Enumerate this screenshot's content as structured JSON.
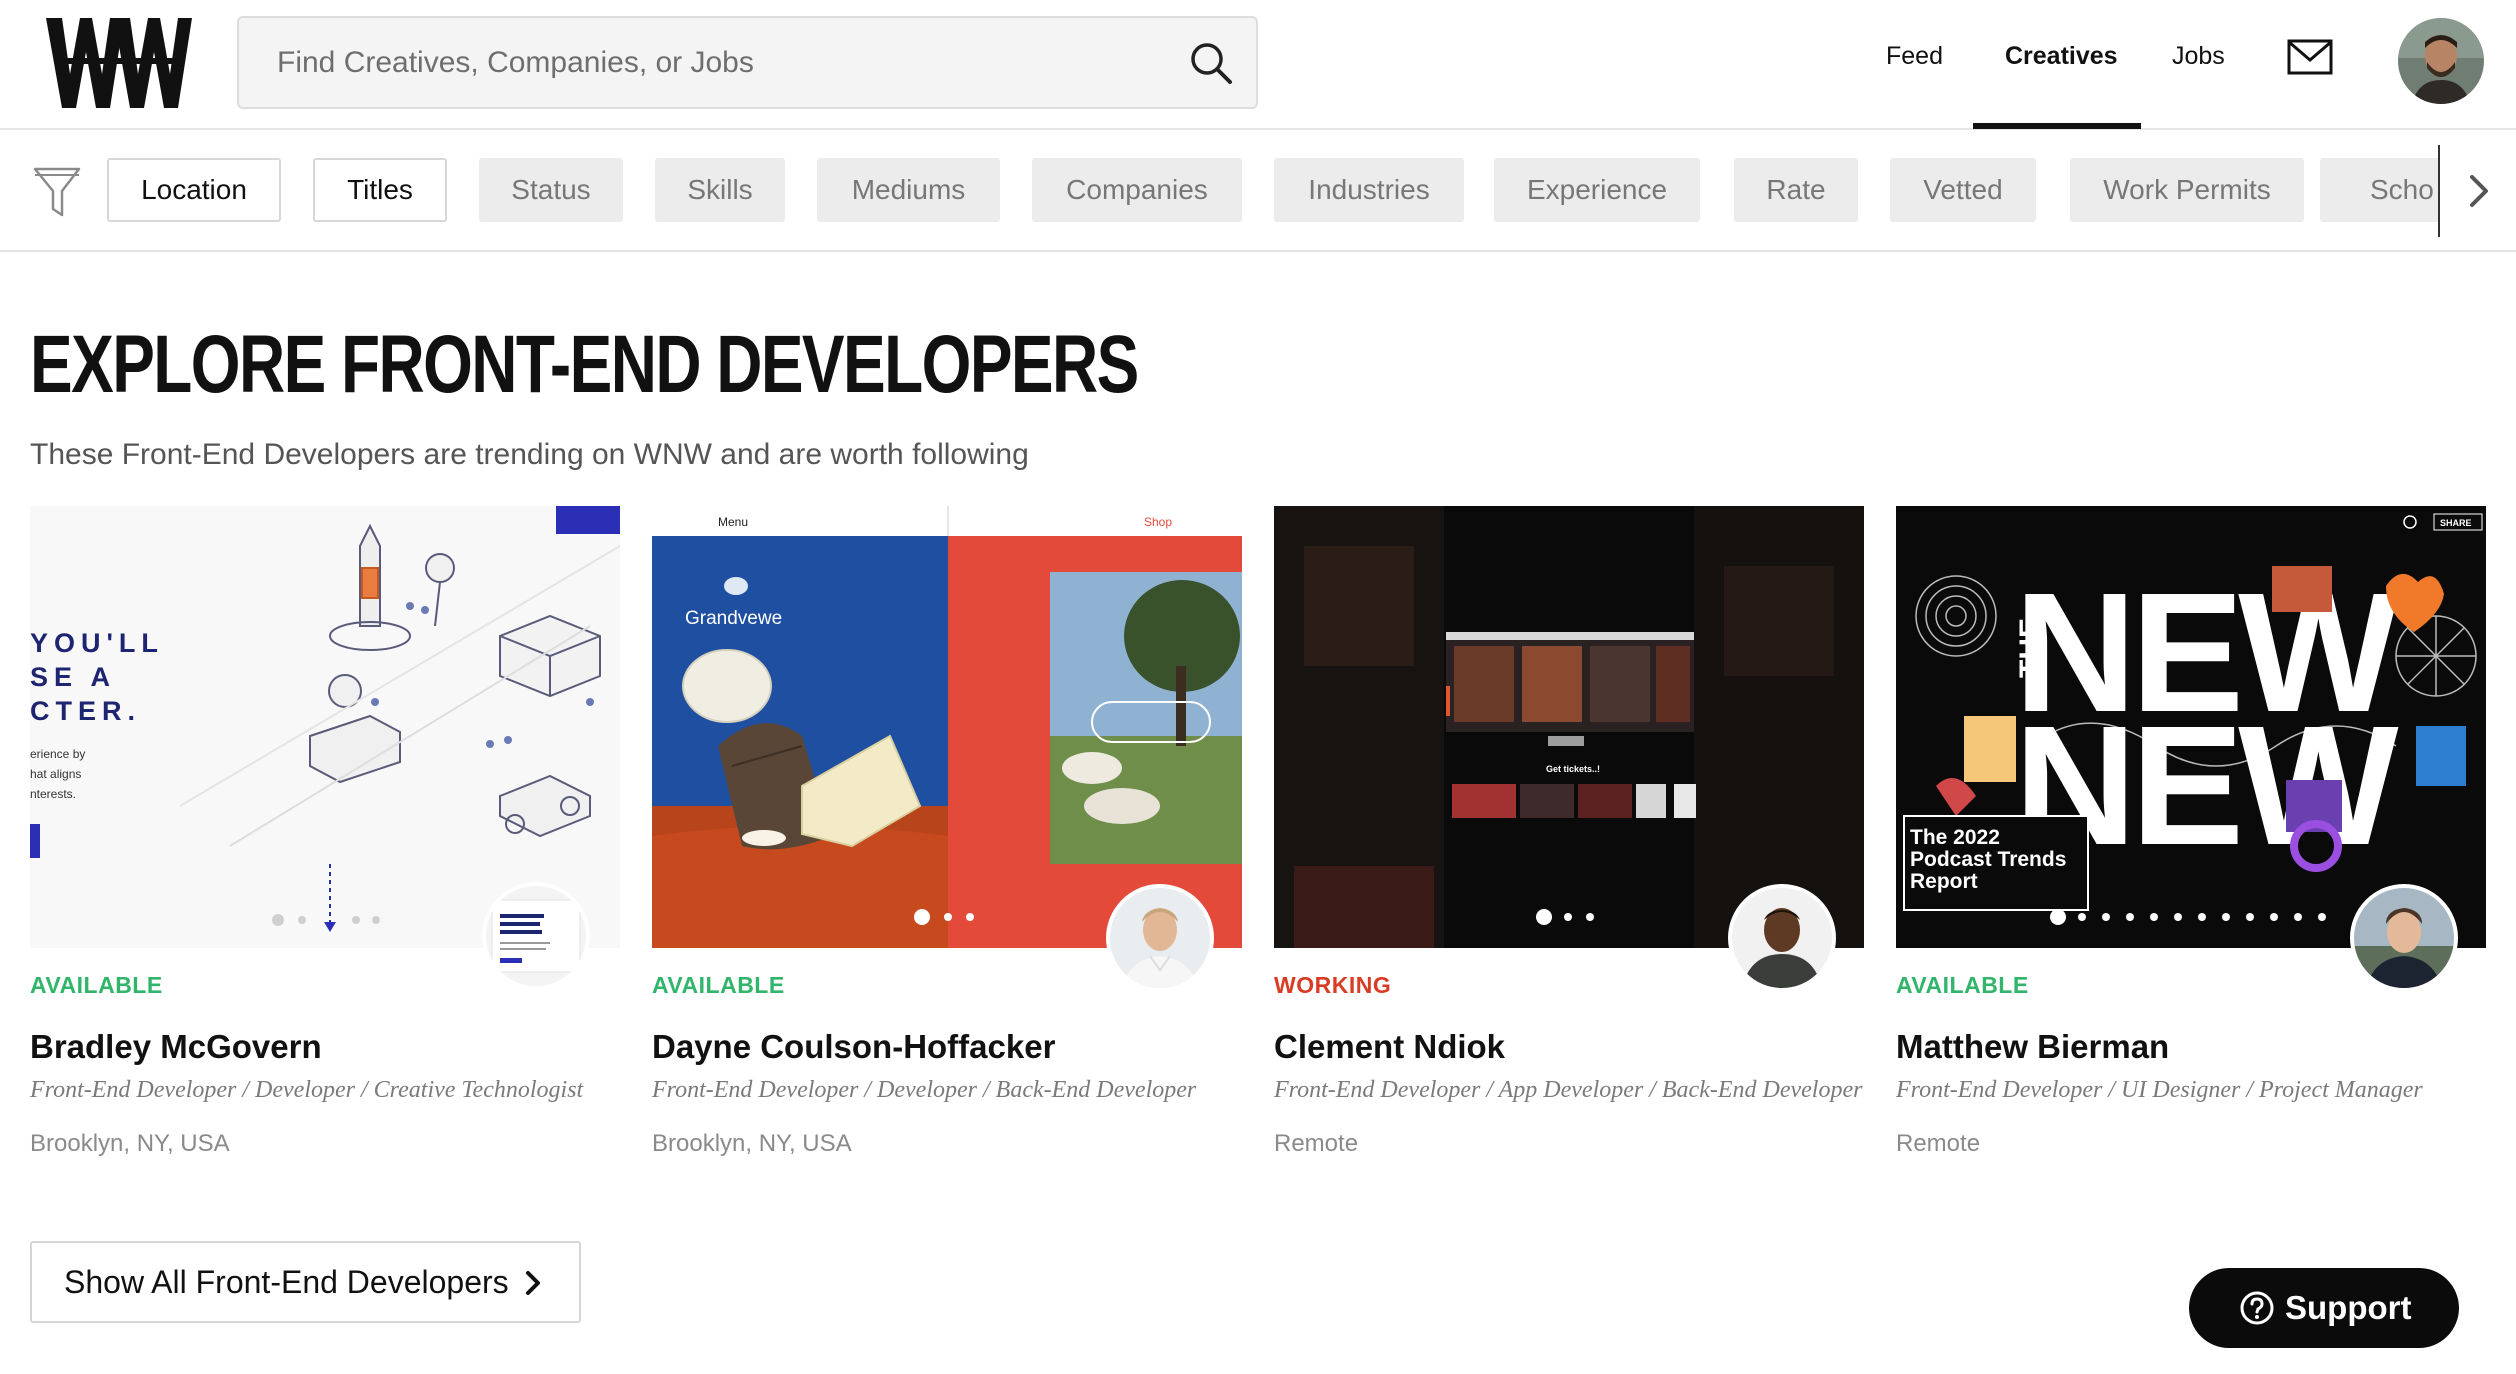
{
  "header": {
    "logo_text": "WNW",
    "search_placeholder": "Find Creatives, Companies, or Jobs",
    "nav": [
      {
        "label": "Feed",
        "active": false
      },
      {
        "label": "Creatives",
        "active": true
      },
      {
        "label": "Jobs",
        "active": false
      }
    ],
    "icons": [
      "search-icon",
      "mail-icon",
      "avatar"
    ]
  },
  "filters": {
    "icon": "funnel-icon",
    "chips": [
      {
        "label": "Location",
        "active": true
      },
      {
        "label": "Titles",
        "active": true
      },
      {
        "label": "Status",
        "active": false
      },
      {
        "label": "Skills",
        "active": false
      },
      {
        "label": "Mediums",
        "active": false
      },
      {
        "label": "Companies",
        "active": false
      },
      {
        "label": "Industries",
        "active": false
      },
      {
        "label": "Experience",
        "active": false
      },
      {
        "label": "Rate",
        "active": false
      },
      {
        "label": "Vetted",
        "active": false
      },
      {
        "label": "Work Permits",
        "active": false
      },
      {
        "label": "Scho",
        "active": false
      }
    ]
  },
  "main": {
    "title": "EXPLORE FRONT-END DEVELOPERS",
    "subtitle": "These Front-End Developers are trending on WNW and are worth following"
  },
  "cards": [
    {
      "status": "AVAILABLE",
      "status_color": "#31b56a",
      "name": "Bradley McGovern",
      "titles": "Front-End Developer / Developer / Creative Technologist",
      "location": "Brooklyn, NY, USA",
      "thumb_text": [
        "YOU'LL",
        "SE A",
        "CTER."
      ],
      "thumb_small": [
        "erience by",
        "hat aligns",
        "nterests."
      ]
    },
    {
      "status": "AVAILABLE",
      "status_color": "#31b56a",
      "name": "Dayne Coulson-Hoffacker",
      "titles": "Front-End Developer / Developer / Back-End Developer",
      "location": "Brooklyn, NY, USA",
      "thumb_text": [
        "Menu",
        "Shop",
        "Grandvewe"
      ]
    },
    {
      "status": "WORKING",
      "status_color": "#d93c25",
      "name": "Clement Ndiok",
      "titles": "Front-End Developer / App Developer / Back-End Developer",
      "location": "Remote",
      "thumb_text": [
        "Get tickets..!"
      ]
    },
    {
      "status": "AVAILABLE",
      "status_color": "#31b56a",
      "name": "Matthew Bierman",
      "titles": "Front-End Developer / UI Designer / Project Manager",
      "location": "Remote",
      "thumb_text": [
        "THE",
        "NEW",
        "NEW",
        "The 2022",
        "Podcast Trends",
        "Report",
        "SHARE"
      ]
    }
  ],
  "footer": {
    "show_all_label": "Show All Front-End Developers",
    "support_label": "Support"
  },
  "colors": {
    "available": "#31b56a",
    "working": "#d93c25",
    "support_bg": "#0b0b0b"
  }
}
